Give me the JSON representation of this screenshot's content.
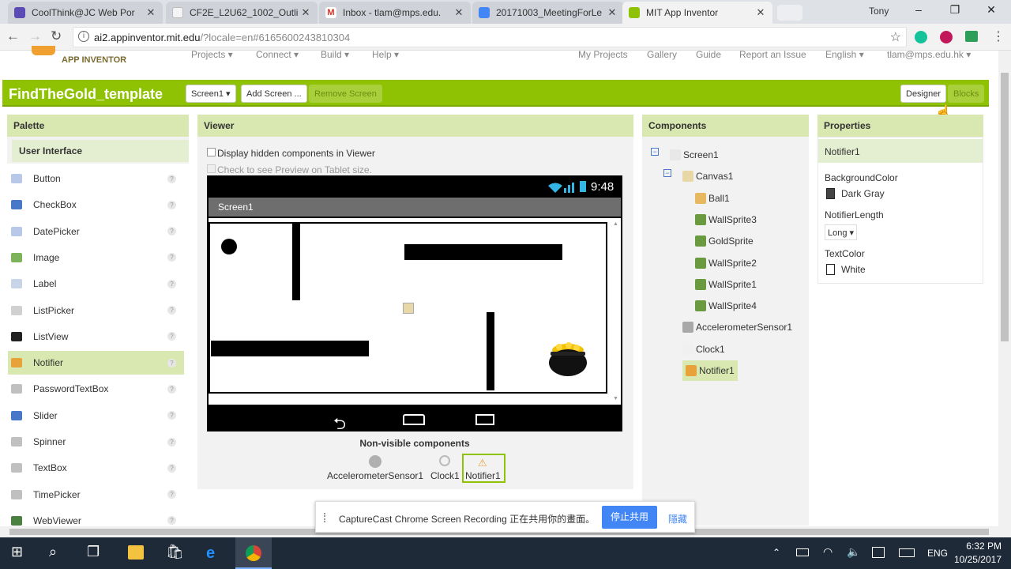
{
  "browser": {
    "tabs": [
      {
        "title": "CoolThink@JC Web Por",
        "favicon_color": "#5a4bb5"
      },
      {
        "title": "CF2E_L2U62_1002_Outli",
        "favicon_color": "#f4f4f4"
      },
      {
        "title": "Inbox - tlam@mps.edu.",
        "favicon_color": "#d93025"
      },
      {
        "title": "20171003_MeetingForLe",
        "favicon_color": "#4285f4"
      },
      {
        "title": "MIT App Inventor",
        "favicon_color": "#8fc202"
      }
    ],
    "user_name": "Tony",
    "url_host": "ai2.appinventor.mit.edu",
    "url_rest": "/?locale=en#6165600243810304"
  },
  "app": {
    "logo_text": "APP INVENTOR",
    "menus": [
      "Projects ▾",
      "Connect ▾",
      "Build ▾",
      "Help ▾"
    ],
    "right_menus": [
      "My Projects",
      "Gallery",
      "Guide",
      "Report an Issue",
      "English ▾",
      "tlam@mps.edu.hk ▾"
    ],
    "project_title": "FindTheGold_template",
    "screen_select": "Screen1 ▾",
    "add_screen": "Add Screen ...",
    "remove_screen": "Remove Screen",
    "designer": "Designer",
    "blocks": "Blocks"
  },
  "palette": {
    "title": "Palette",
    "section": "User Interface",
    "items": [
      {
        "label": "Button",
        "color": "#b8c8e8"
      },
      {
        "label": "CheckBox",
        "color": "#4a78c8"
      },
      {
        "label": "DatePicker",
        "color": "#b8c8e8"
      },
      {
        "label": "Image",
        "color": "#7db35a"
      },
      {
        "label": "Label",
        "color": "#c8d4e8"
      },
      {
        "label": "ListPicker",
        "color": "#d0d0d0"
      },
      {
        "label": "ListView",
        "color": "#222222"
      },
      {
        "label": "Notifier",
        "color": "#e8a23a"
      },
      {
        "label": "PasswordTextBox",
        "color": "#c0c0c0"
      },
      {
        "label": "Slider",
        "color": "#4a78c8"
      },
      {
        "label": "Spinner",
        "color": "#c0c0c0"
      },
      {
        "label": "TextBox",
        "color": "#c0c0c0"
      },
      {
        "label": "TimePicker",
        "color": "#c0c0c0"
      },
      {
        "label": "WebViewer",
        "color": "#4a8040"
      }
    ],
    "selected": "Notifier"
  },
  "viewer": {
    "title": "Viewer",
    "hidden_label": "Display hidden components in Viewer",
    "tablet_label": "Check to see Preview on Tablet size.",
    "time": "9:48",
    "screen_title": "Screen1",
    "nonvisible_title": "Non-visible components",
    "nonvisible": [
      "AccelerometerSensor1",
      "Clock1",
      "Notifier1"
    ]
  },
  "components": {
    "title": "Components",
    "tree": [
      {
        "label": "Screen1",
        "level": 0,
        "color": "#e8e8e8"
      },
      {
        "label": "Canvas1",
        "level": 1,
        "color": "#e8d8a8"
      },
      {
        "label": "Ball1",
        "level": 2,
        "color": "#e8b860"
      },
      {
        "label": "WallSprite3",
        "level": 2,
        "color": "#6a9a40"
      },
      {
        "label": "GoldSprite",
        "level": 2,
        "color": "#6a9a40"
      },
      {
        "label": "WallSprite2",
        "level": 2,
        "color": "#6a9a40"
      },
      {
        "label": "WallSprite1",
        "level": 2,
        "color": "#6a9a40"
      },
      {
        "label": "WallSprite4",
        "level": 2,
        "color": "#6a9a40"
      },
      {
        "label": "AccelerometerSensor1",
        "level": 1,
        "color": "#a8a8a8"
      },
      {
        "label": "Clock1",
        "level": 1,
        "color": "#f0f0f0"
      },
      {
        "label": "Notifier1",
        "level": 1,
        "color": "#e8a23a"
      }
    ],
    "selected": "Notifier1"
  },
  "properties": {
    "title": "Properties",
    "component": "Notifier1",
    "background_label": "BackgroundColor",
    "background_value": "Dark Gray",
    "length_label": "NotifierLength",
    "length_value": "Long ▾",
    "text_label": "TextColor",
    "text_value": "White"
  },
  "sharebar": {
    "text": "CaptureCast Chrome Screen Recording 正在共用你的畫面。",
    "stop": "停止共用",
    "hide": "隱藏"
  },
  "taskbar": {
    "lang": "ENG",
    "time": "6:32 PM",
    "date": "10/25/2017"
  }
}
